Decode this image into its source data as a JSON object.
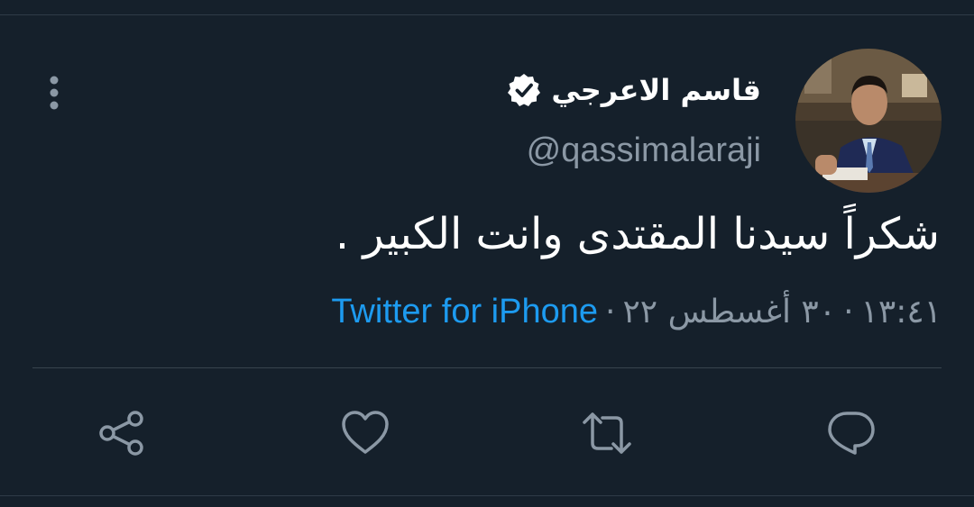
{
  "tweet": {
    "display_name": "قاسم الاعرجي",
    "handle": "@qassimalaraji",
    "text": "شكراً سيدنا المقتدى وانت الكبير .",
    "time": "١٣:٤١",
    "date": "٣٠ أغسطس ٢٢",
    "separator": "·",
    "source": "Twitter for iPhone"
  },
  "icons": {
    "verified": "verified-badge-icon",
    "more": "more-vertical-icon",
    "share": "share-icon",
    "like": "heart-icon",
    "retweet": "retweet-icon",
    "reply": "reply-icon"
  },
  "colors": {
    "background": "#15202b",
    "text_primary": "#ffffff",
    "text_secondary": "#8b98a5",
    "accent": "#1d9bf0",
    "divider": "#38444d"
  }
}
